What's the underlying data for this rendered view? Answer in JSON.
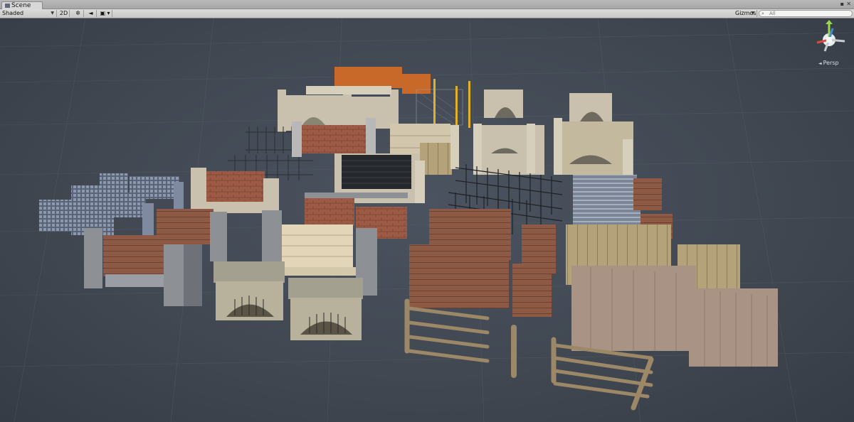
{
  "window": {
    "tab_label": "Scene",
    "tab_icon": "scene-icon",
    "menu_icon": "window-menu-icon",
    "close_icon": "lock-icon"
  },
  "toolbar": {
    "draw_mode": "Shaded",
    "mode_2d": "2D",
    "lighting_icon": "sun-icon",
    "audio_icon": "speaker-icon",
    "effects_icon": "image-icon",
    "gizmos_label": "Gizmos",
    "search_placeholder": "All",
    "search_icon": "search-icon"
  },
  "scene_view": {
    "projection_label": "Persp",
    "gizmo_axes": [
      "x",
      "y",
      "z"
    ],
    "gizmo_colors": {
      "x": "#d94b3d",
      "y": "#9cd84a",
      "z": "#4a84d8"
    }
  },
  "colors": {
    "scene_bg": "#414852",
    "grid": "#5a626d",
    "brick": "#9c5a45",
    "stone": "#c9c1ad",
    "wood_light": "#b3a27a",
    "wood_plank": "#8f735c",
    "metal": "#25282c",
    "blue_stone": "#7f8aa1",
    "rust": "#c8692a",
    "concrete": "#8d9196"
  }
}
